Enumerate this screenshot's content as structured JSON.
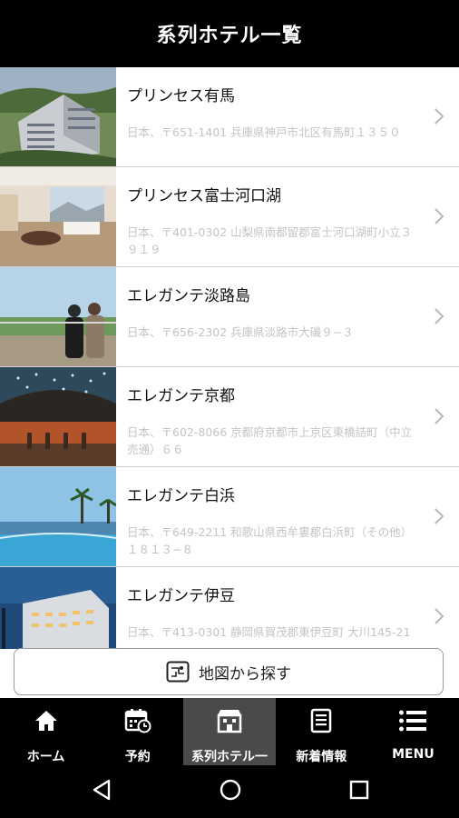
{
  "header": {
    "title": "系列ホテル一覧"
  },
  "hotels": [
    {
      "name": "プリンセス有馬",
      "address": "日本、〒651-1401 兵庫県神戸市北区有馬町１３５０"
    },
    {
      "name": "プリンセス富士河口湖",
      "address": "日本、〒401-0302 山梨県南都留郡富士河口湖町小立３９１９"
    },
    {
      "name": "エレガンテ淡路島",
      "address": "日本、〒656-2302 兵庫県淡路市大磯９−３"
    },
    {
      "name": "エレガンテ京都",
      "address": "日本、〒602-8066 京都府京都市上京区東橋詰町（中立売通）６６"
    },
    {
      "name": "エレガンテ白浜",
      "address": "日本、〒649-2211 和歌山県西牟婁郡白浜町（その他）１８１３−８"
    },
    {
      "name": "エレガンテ伊豆",
      "address": "日本、〒413-0301 静岡県賀茂郡東伊豆町 大川145-21"
    }
  ],
  "map_button": {
    "label": "地図から探す",
    "icon": "map-icon"
  },
  "tabs": [
    {
      "label": "ホーム",
      "icon": "home-icon"
    },
    {
      "label": "予約",
      "icon": "calendar-icon"
    },
    {
      "label": "系列ホテル一",
      "icon": "hotel-icon"
    },
    {
      "label": "新着情報",
      "icon": "news-icon"
    },
    {
      "label": "MENU",
      "icon": "menu-icon"
    }
  ],
  "colors": {
    "bar": "#000000",
    "active_tab": "#4a4a4a",
    "address": "#c4c4c4"
  }
}
